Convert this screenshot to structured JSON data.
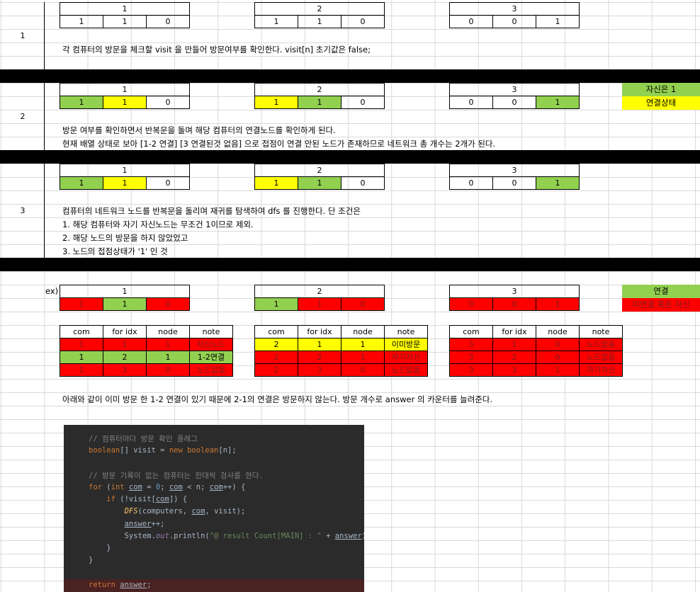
{
  "steps": [
    "1",
    "2",
    "3"
  ],
  "step1": {
    "node_headers": [
      "1",
      "2",
      "3"
    ],
    "rows": [
      [
        "1",
        "1",
        "0"
      ],
      [
        "1",
        "1",
        "0"
      ],
      [
        "0",
        "0",
        "1"
      ]
    ],
    "text": "각 컴퓨터의 방문을 체크할 visit 을 만들어 방문여부를 확인한다. visit[n] 초기값은 false;"
  },
  "step2": {
    "node_headers": [
      "1",
      "2",
      "3"
    ],
    "rows": [
      [
        "1",
        "1",
        "0"
      ],
      [
        "1",
        "1",
        "0"
      ],
      [
        "0",
        "0",
        "1"
      ]
    ],
    "legend": [
      "자신은 1",
      "연결상태"
    ],
    "text1": "방문 여부를 확인하면서 반복문을 돌며 해당 컴퓨터의 연결노드를 확인하게 된다.",
    "text2": "현재 배열 상태로 보아 [1-2 연결] [3 연결된것 없음] 으로 접점이 연결 안된 노드가 존재하므로 네트워크 총 개수는 2개가 된다."
  },
  "step3": {
    "node_headers": [
      "1",
      "2",
      "3"
    ],
    "rows": [
      [
        "1",
        "1",
        "0"
      ],
      [
        "1",
        "1",
        "0"
      ],
      [
        "0",
        "0",
        "1"
      ]
    ],
    "lines": [
      "컴퓨터의 네트워크 노드를 반복문을 돌리며 재귀를 탐색하여 dfs 를 진행한다. 단 조건은",
      "1. 해당 컴퓨터와 자기 자신노드는 무조건 1이므로 제외.",
      "2. 해당 노드의 방문을 하지 않았었고",
      "3. 노드의 접점상태가 '1' 인 것"
    ]
  },
  "example": {
    "label": "ex)",
    "node_headers": [
      "1",
      "2",
      "3"
    ],
    "rows": [
      [
        "1",
        "1",
        "0"
      ],
      [
        "1",
        "1",
        "0"
      ],
      [
        "0",
        "0",
        "1"
      ]
    ],
    "legend": [
      "연결",
      "미연결 혹은 자신"
    ],
    "trace_headers": [
      "com",
      "for idx",
      "node",
      "note"
    ],
    "traces": [
      [
        [
          "1",
          "1",
          "1",
          "자신노드"
        ],
        [
          "1",
          "2",
          "1",
          "1-2연결"
        ],
        [
          "1",
          "3",
          "0",
          "노드없음"
        ]
      ],
      [
        [
          "2",
          "1",
          "1",
          "이미방문"
        ],
        [
          "2",
          "2",
          "1",
          "자기자신"
        ],
        [
          "2",
          "3",
          "0",
          "노드없음"
        ]
      ],
      [
        [
          "3",
          "1",
          "0",
          "노드없음"
        ],
        [
          "3",
          "2",
          "0",
          "노드없음"
        ],
        [
          "3",
          "3",
          "1",
          "자기자신"
        ]
      ]
    ],
    "summary": "아래와 같이 이미 방문 한 1-2 연결이 있기 때문에 2-1의 연결은 방문하지 않는다. 방문 개수로 answer 의 카운터를 늘려준다."
  },
  "code": {
    "comment1": "// 컴퓨터마다 방문 확인 플레그",
    "line1_type": "boolean",
    "line1_rest": "[] visit = ",
    "line1_new": "new",
    "line1_type2": "boolean",
    "line1_end": "[n];",
    "comment2": "// 방문 기록이 없는 컴퓨터는 한대씩 검사를 한다.",
    "for_kw": "for",
    "int_kw": "int",
    "com": "com",
    "zero": "0",
    "n": "n",
    "if_kw": "if",
    "visit": "visit",
    "dfs": "DFS",
    "computers": "computers",
    "answer": "answer",
    "println_a": "System.",
    "out": "out",
    "println_b": ".println(",
    "str": "\"@ result Count[MAIN] : \"",
    "return_kw": "return"
  },
  "colors": {
    "green": "#92d050",
    "yellow": "#ffff00",
    "red": "#ff0000",
    "code_bg": "#2b2b2b"
  }
}
